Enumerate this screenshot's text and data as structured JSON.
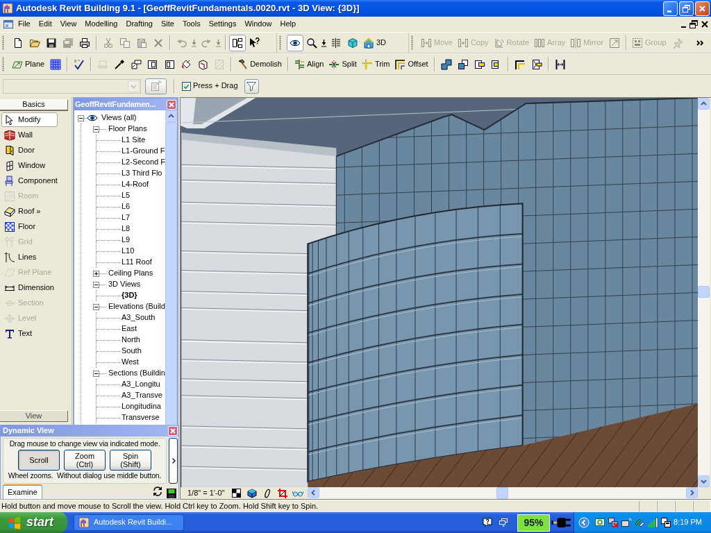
{
  "window": {
    "title": "Autodesk Revit Building 9.1 - [GeoffRevitFundamentals.0020.rvt - 3D View: {3D}]"
  },
  "menu_bar": {
    "items": [
      "File",
      "Edit",
      "View",
      "Modelling",
      "Drafting",
      "Site",
      "Tools",
      "Settings",
      "Window",
      "Help"
    ]
  },
  "toolbar_rows": [
    [
      {
        "groups": [
          [
            {
              "kind": "icon",
              "disabled": false,
              "pressed": false
            },
            {
              "kind": "icon",
              "disabled": false,
              "pressed": false
            },
            {
              "kind": "icon",
              "disabled": false,
              "pressed": false
            },
            {
              "kind": "icon",
              "disabled": true,
              "pressed": false
            },
            {
              "kind": "icon",
              "disabled": false,
              "pressed": false
            }
          ],
          [
            {
              "kind": "icon",
              "disabled": true,
              "pressed": false
            },
            {
              "kind": "icon",
              "disabled": true,
              "pressed": false
            },
            {
              "kind": "icon",
              "disabled": true,
              "pressed": false
            },
            {
              "kind": "icon",
              "disabled": true,
              "pressed": false
            }
          ],
          [
            {
              "kind": "icon",
              "disabled": true,
              "pressed": false
            },
            {
              "kind": "arrow",
              "disabled": true,
              "pressed": false
            },
            {
              "kind": "icon",
              "disabled": true,
              "pressed": false
            },
            {
              "kind": "arrow",
              "disabled": true,
              "pressed": false
            }
          ],
          [
            {
              "kind": "icon",
              "disabled": false,
              "pressed": true
            },
            {
              "kind": "icon",
              "disabled": false,
              "pressed": false
            }
          ]
        ]
      },
      {
        "groups": [
          [
            {
              "kind": "icon",
              "disabled": false,
              "pressed": true
            },
            {
              "kind": "icon",
              "disabled": false,
              "pressed": false
            },
            {
              "kind": "arrow",
              "disabled": false,
              "pressed": false
            },
            {
              "kind": "icon",
              "disabled": false,
              "pressed": false
            },
            {
              "kind": "icon",
              "disabled": false,
              "pressed": false
            },
            {
              "kind": "labeled",
              "label": "3D",
              "disabled": false,
              "pressed": false
            }
          ]
        ]
      },
      {
        "groups": [
          [
            {
              "kind": "labeled",
              "label": "Move",
              "disabled": true,
              "pressed": false
            },
            {
              "kind": "labeled",
              "label": "Copy",
              "disabled": true,
              "pressed": false
            },
            {
              "kind": "labeled",
              "label": "Rotate",
              "disabled": true,
              "pressed": false
            },
            {
              "kind": "labeled",
              "label": "Array",
              "disabled": true,
              "pressed": false
            },
            {
              "kind": "labeled",
              "label": "Mirror",
              "disabled": true,
              "pressed": false
            },
            {
              "kind": "icon",
              "disabled": true,
              "pressed": false
            }
          ],
          [
            {
              "kind": "labeled",
              "label": "Group",
              "disabled": true,
              "pressed": false
            },
            {
              "kind": "icon",
              "disabled": true,
              "pressed": false
            },
            {
              "kind": "icon",
              "disabled": false,
              "pressed": false
            }
          ]
        ]
      }
    ],
    [
      {
        "groups": [
          [
            {
              "kind": "labeled",
              "label": "Plane",
              "disabled": false,
              "pressed": false
            },
            {
              "kind": "icon",
              "disabled": false,
              "pressed": false
            }
          ],
          [
            {
              "kind": "icon",
              "disabled": false,
              "pressed": false
            }
          ],
          [
            {
              "kind": "icon",
              "disabled": true,
              "pressed": false
            },
            {
              "kind": "icon",
              "disabled": false,
              "pressed": false
            },
            {
              "kind": "icon",
              "disabled": false,
              "pressed": false
            },
            {
              "kind": "icon",
              "disabled": false,
              "pressed": false
            },
            {
              "kind": "icon",
              "disabled": false,
              "pressed": false
            },
            {
              "kind": "icon",
              "disabled": false,
              "pressed": false
            },
            {
              "kind": "icon",
              "disabled": false,
              "pressed": false
            },
            {
              "kind": "icon",
              "disabled": true,
              "pressed": false
            }
          ],
          [
            {
              "kind": "labeled",
              "label": "Demolish",
              "disabled": false,
              "pressed": false
            }
          ],
          [
            {
              "kind": "labeled",
              "label": "Align",
              "disabled": false,
              "pressed": false
            },
            {
              "kind": "labeled",
              "label": "Split",
              "disabled": false,
              "pressed": false
            },
            {
              "kind": "labeled",
              "label": "Trim",
              "disabled": false,
              "pressed": false
            },
            {
              "kind": "labeled",
              "label": "Offset",
              "disabled": false,
              "pressed": false
            }
          ],
          [
            {
              "kind": "icon",
              "disabled": false,
              "pressed": false
            },
            {
              "kind": "icon",
              "disabled": false,
              "pressed": false
            },
            {
              "kind": "icon",
              "disabled": false,
              "pressed": false
            },
            {
              "kind": "icon",
              "disabled": false,
              "pressed": false
            }
          ],
          [
            {
              "kind": "icon",
              "disabled": false,
              "pressed": false
            },
            {
              "kind": "icon",
              "disabled": false,
              "pressed": false
            }
          ],
          [
            {
              "kind": "icon",
              "disabled": false,
              "pressed": false
            }
          ]
        ]
      }
    ]
  ],
  "options_bar": {
    "type_selector": {
      "disabled": true
    },
    "properties_button": {
      "disabled": true
    },
    "press_drag": {
      "label": "Press + Drag",
      "checked": true
    }
  },
  "design_bar": {
    "tabs": [
      {
        "label": "Basics",
        "selected": true
      },
      {
        "label": "View",
        "selected": false
      }
    ],
    "items": [
      {
        "label": "Modify",
        "selected": true,
        "disabled": false
      },
      {
        "label": "Wall",
        "selected": false,
        "disabled": false
      },
      {
        "label": "Door",
        "selected": false,
        "disabled": false
      },
      {
        "label": "Window",
        "selected": false,
        "disabled": false
      },
      {
        "label": "Component",
        "selected": false,
        "disabled": false
      },
      {
        "label": "Room",
        "selected": false,
        "disabled": true
      },
      {
        "label": "Roof »",
        "selected": false,
        "disabled": false
      },
      {
        "label": "Floor",
        "selected": false,
        "disabled": false
      },
      {
        "label": "Grid",
        "selected": false,
        "disabled": true
      },
      {
        "label": "Lines",
        "selected": false,
        "disabled": false
      },
      {
        "label": "Ref Plane",
        "selected": false,
        "disabled": true
      },
      {
        "label": "Dimension",
        "selected": false,
        "disabled": false
      },
      {
        "label": "Section",
        "selected": false,
        "disabled": true
      },
      {
        "label": "Level",
        "selected": false,
        "disabled": true
      },
      {
        "label": "Text",
        "selected": false,
        "disabled": false
      }
    ]
  },
  "project_browser": {
    "title": "GeoffRevitFundamen...",
    "tree": [
      {
        "label": "Views (all)",
        "expanded": true,
        "current": false,
        "children": [
          {
            "label": "Floor Plans",
            "expanded": true,
            "current": false,
            "children": [
              {
                "label": "L1 Site",
                "current": false
              },
              {
                "label": "L1-Ground F",
                "current": false
              },
              {
                "label": "L2-Second F",
                "current": false
              },
              {
                "label": "L3 Third Flo",
                "current": false
              },
              {
                "label": "L4-Roof",
                "current": false
              },
              {
                "label": "L5",
                "current": false
              },
              {
                "label": "L6",
                "current": false
              },
              {
                "label": "L7",
                "current": false
              },
              {
                "label": "L8",
                "current": false
              },
              {
                "label": "L9",
                "current": false
              },
              {
                "label": "L10",
                "current": false
              },
              {
                "label": "L11 Roof",
                "current": false
              }
            ]
          },
          {
            "label": "Ceiling Plans",
            "expanded": false,
            "current": false
          },
          {
            "label": "3D Views",
            "expanded": true,
            "current": false,
            "children": [
              {
                "label": "{3D}",
                "current": true
              }
            ]
          },
          {
            "label": "Elevations (Build",
            "expanded": true,
            "current": false,
            "children": [
              {
                "label": "A3_South",
                "current": false
              },
              {
                "label": "East",
                "current": false
              },
              {
                "label": "North",
                "current": false
              },
              {
                "label": "South",
                "current": false
              },
              {
                "label": "West",
                "current": false
              }
            ]
          },
          {
            "label": "Sections (Buildin",
            "expanded": true,
            "current": false,
            "children": [
              {
                "label": "A3_Longitu",
                "current": false
              },
              {
                "label": "A3_Transve",
                "current": false
              },
              {
                "label": "Longitudina",
                "current": false
              },
              {
                "label": "Transverse",
                "current": false
              }
            ]
          }
        ]
      }
    ]
  },
  "view": {
    "scale": "1/8\" = 1'-0\""
  },
  "dynamic_view": {
    "title": "Dynamic View",
    "hint": "Drag mouse to change view via indicated mode.",
    "modes": [
      {
        "label": "Scroll",
        "selected": true
      },
      {
        "label": "Zoom",
        "key": "(Ctrl)",
        "selected": false
      },
      {
        "label": "Spin",
        "key": "(Shift)",
        "selected": false
      }
    ],
    "footer": "Wheel zooms.  Without dialog use middle button.",
    "tabs": [
      {
        "label": "Examine",
        "selected": true
      }
    ]
  },
  "status_bar": {
    "text": "Hold button and move mouse to Scroll the view. Hold Ctrl key to Zoom. Hold Shift key to Spin."
  },
  "taskbar": {
    "start": "start",
    "tasks": [
      {
        "label": "Autodesk Revit Buildi...",
        "selected": false
      }
    ],
    "battery": "95%",
    "clock": "8:19 PM"
  }
}
